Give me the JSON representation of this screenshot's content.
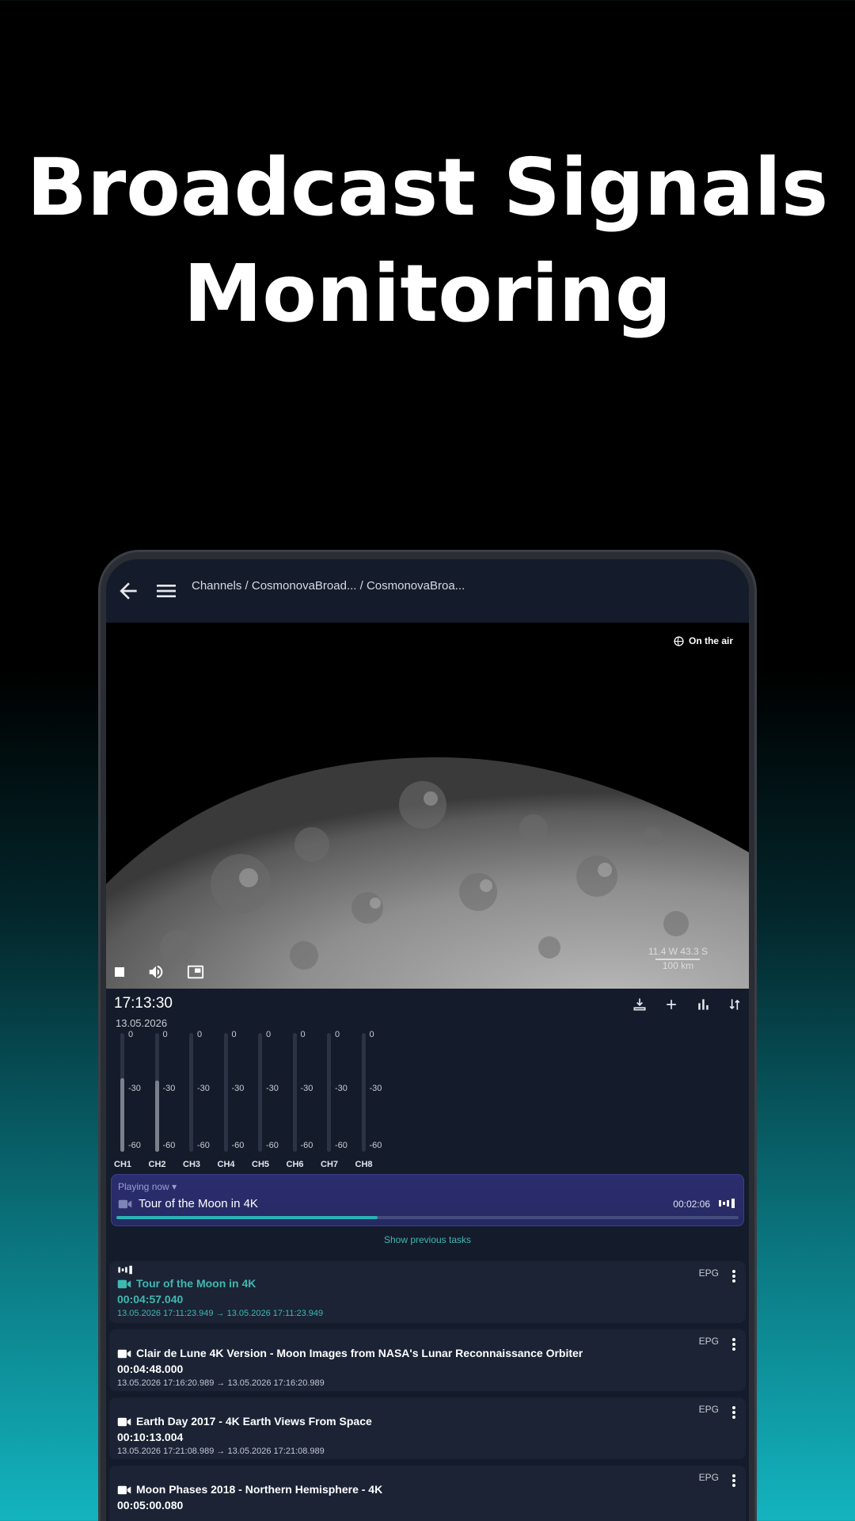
{
  "hero": {
    "line1": "Broadcast Signals",
    "line2": "Monitoring"
  },
  "appbar": {
    "breadcrumb": "Channels / CosmonovaBroad...  / CosmonovaBroa..."
  },
  "video": {
    "status": "On the air",
    "scale_coords": "11.4  W 43.3  S",
    "scale_dist": "100 km"
  },
  "clock": {
    "time": "17:13:30",
    "date": "13.05.2026"
  },
  "meters": {
    "ticks": [
      "0",
      "-30",
      "-60"
    ],
    "channels": [
      {
        "label": "CH1",
        "level": 0.62
      },
      {
        "label": "CH2",
        "level": 0.6
      },
      {
        "label": "CH3",
        "level": 0
      },
      {
        "label": "CH4",
        "level": 0
      },
      {
        "label": "CH5",
        "level": 0
      },
      {
        "label": "CH6",
        "level": 0
      },
      {
        "label": "CH7",
        "level": 0
      },
      {
        "label": "CH8",
        "level": 0
      }
    ]
  },
  "playing": {
    "header": "Playing now",
    "title": "Tour of the Moon in 4K",
    "elapsed": "00:02:06",
    "progress": 0.42
  },
  "show_prev": "Show previous tasks",
  "tasks": [
    {
      "title": "Tour of the Moon in 4K",
      "duration": "00:04:57.040",
      "range": "13.05.2026 17:11:23.949 → 13.05.2026 17:11:23.949",
      "tag": "EPG"
    },
    {
      "title": "Clair de Lune 4K Version - Moon Images from NASA's Lunar Reconnaissance Orbiter",
      "duration": "00:04:48.000",
      "range": "13.05.2026 17:16:20.989 → 13.05.2026 17:16:20.989",
      "tag": "EPG"
    },
    {
      "title": "Earth Day 2017 - 4K Earth Views From Space",
      "duration": "00:10:13.004",
      "range": "13.05.2026 17:21:08.989 → 13.05.2026 17:21:08.989",
      "tag": "EPG"
    },
    {
      "title": "Moon Phases 2018 - Northern Hemisphere - 4K",
      "duration": "00:05:00.080",
      "range": "",
      "tag": "EPG"
    }
  ]
}
